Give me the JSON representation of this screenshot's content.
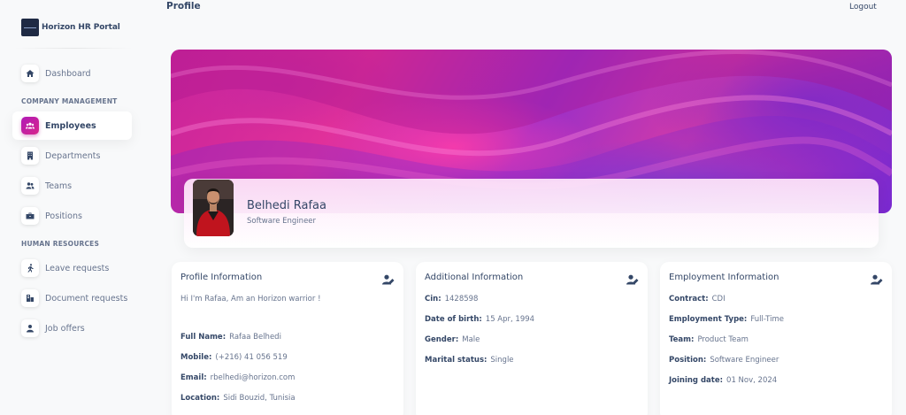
{
  "brand": {
    "name": "Horizon HR Portal"
  },
  "header": {
    "title": "Profile",
    "logout_label": "Logout"
  },
  "sidebar": {
    "items": [
      {
        "label": "Dashboard",
        "icon": "home-icon"
      },
      {
        "label": "Employees",
        "icon": "people-icon",
        "active": true
      },
      {
        "label": "Departments",
        "icon": "building-icon"
      },
      {
        "label": "Teams",
        "icon": "group-icon"
      },
      {
        "label": "Positions",
        "icon": "briefcase-icon"
      },
      {
        "label": "Leave requests",
        "icon": "walking-icon"
      },
      {
        "label": "Document requests",
        "icon": "document-building-icon"
      },
      {
        "label": "Job offers",
        "icon": "person-icon"
      }
    ],
    "sections": [
      "COMPANY MANAGEMENT",
      "HUMAN RESOURCES"
    ]
  },
  "profile": {
    "name": "Belhedi Rafaa",
    "role": "Software Engineer"
  },
  "profile_info": {
    "title": "Profile Information",
    "bio": "Hi I'm Rafaa, Am an Horizon warrior !",
    "fields": [
      {
        "label": "Full Name:",
        "value": "Rafaa Belhedi"
      },
      {
        "label": "Mobile:",
        "value": "(+216) 41 056 519"
      },
      {
        "label": "Email:",
        "value": "rbelhedi@horizon.com"
      },
      {
        "label": "Location:",
        "value": "Sidi Bouzid, Tunisia"
      }
    ]
  },
  "additional_info": {
    "title": "Additional Information",
    "fields": [
      {
        "label": "Cin:",
        "value": "1428598"
      },
      {
        "label": "Date of birth:",
        "value": "15 Apr, 1994"
      },
      {
        "label": "Gender:",
        "value": "Male"
      },
      {
        "label": "Marital status:",
        "value": "Single"
      }
    ]
  },
  "employment_info": {
    "title": "Employment Information",
    "fields": [
      {
        "label": "Contract:",
        "value": "CDI"
      },
      {
        "label": "Employment Type:",
        "value": "Full-Time"
      },
      {
        "label": "Team:",
        "value": "Product Team"
      },
      {
        "label": "Position:",
        "value": "Software Engineer"
      },
      {
        "label": "Joining date:",
        "value": "01 Nov, 2024"
      }
    ]
  },
  "colors": {
    "accent": "#c2189e",
    "text": "#344767",
    "muted": "#67748e",
    "background": "#f8f9fa"
  }
}
